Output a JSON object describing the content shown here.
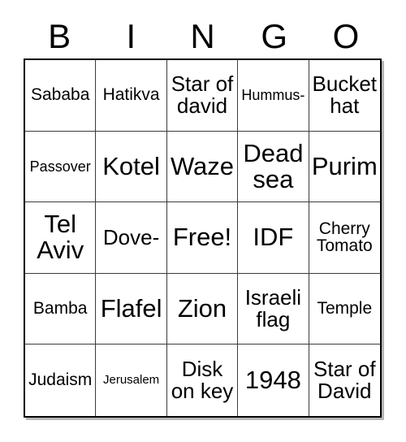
{
  "card": {
    "header_letters": [
      "B",
      "I",
      "N",
      "G",
      "O"
    ],
    "columns": 5,
    "rows": 5,
    "free_space_label": "Free!",
    "colors": {
      "background": "#ffffff",
      "text": "#000000",
      "grid_line": "#3b3b3b",
      "border": "#000000"
    },
    "cells": [
      {
        "text": "Sababa",
        "size": "md"
      },
      {
        "text": "Hatikva",
        "size": "md"
      },
      {
        "text": "Star of david",
        "size": "lg"
      },
      {
        "text": "Hummus-",
        "size": "sm"
      },
      {
        "text": "Bucket hat",
        "size": "lg"
      },
      {
        "text": "Passover",
        "size": "sm"
      },
      {
        "text": "Kotel",
        "size": "xl"
      },
      {
        "text": "Waze",
        "size": "xl"
      },
      {
        "text": "Dead sea",
        "size": "xl"
      },
      {
        "text": "Purim",
        "size": "xl"
      },
      {
        "text": "Tel Aviv",
        "size": "xl"
      },
      {
        "text": "Dove-",
        "size": "lg"
      },
      {
        "text": "Free!",
        "size": "xl"
      },
      {
        "text": "IDF",
        "size": "xl"
      },
      {
        "text": "Cherry Tomato",
        "size": "md"
      },
      {
        "text": "Bamba",
        "size": "md"
      },
      {
        "text": "Flafel",
        "size": "xl"
      },
      {
        "text": "Zion",
        "size": "xl"
      },
      {
        "text": "Israeli flag",
        "size": "lg"
      },
      {
        "text": "Temple",
        "size": "md"
      },
      {
        "text": "Judaism",
        "size": "md"
      },
      {
        "text": "Jerusalem",
        "size": "xs"
      },
      {
        "text": "Disk on key",
        "size": "lg"
      },
      {
        "text": "1948",
        "size": "xl"
      },
      {
        "text": "Star of David",
        "size": "lg"
      }
    ]
  }
}
